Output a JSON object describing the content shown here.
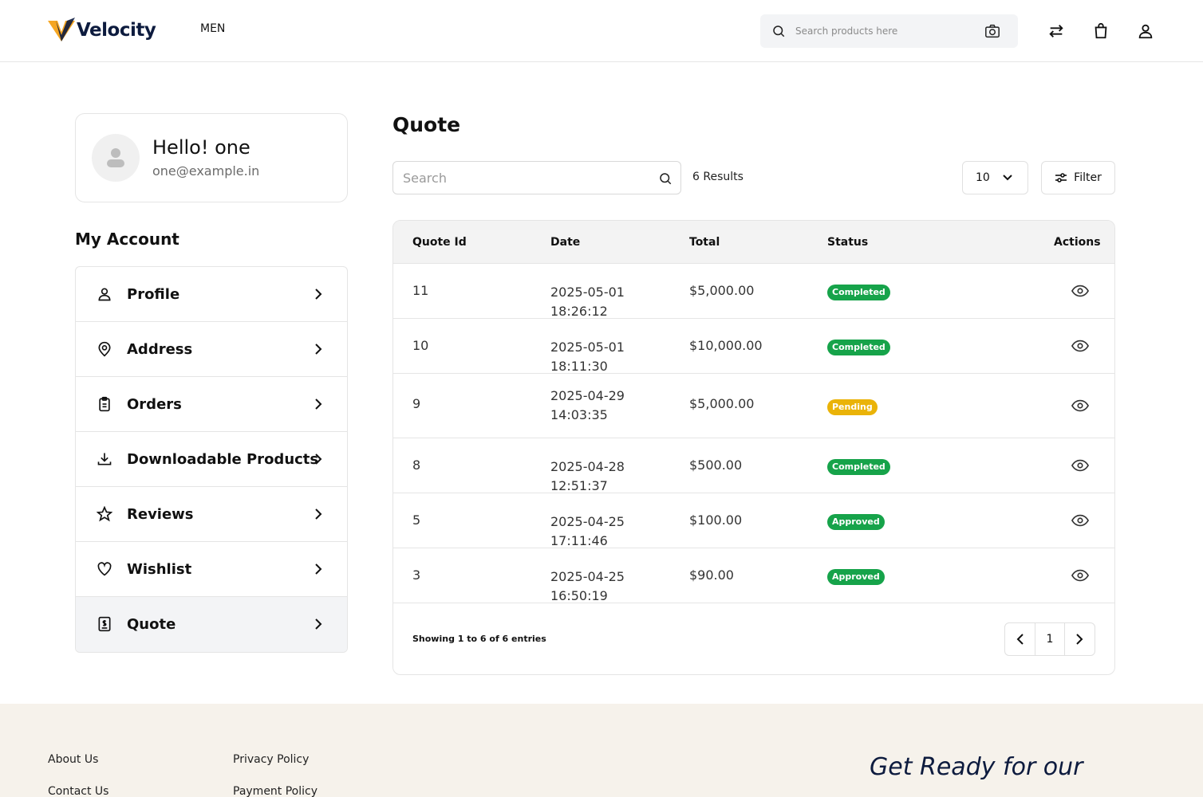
{
  "header": {
    "brand": "Velocity",
    "nav": [
      "MEN"
    ],
    "search_placeholder": "Search products here"
  },
  "profile": {
    "greeting": "Hello! one",
    "email": "one@example.in"
  },
  "sidebar": {
    "title": "My Account",
    "items": [
      {
        "label": "Profile",
        "icon": "user-icon"
      },
      {
        "label": "Address",
        "icon": "location-pin-icon"
      },
      {
        "label": "Orders",
        "icon": "clipboard-icon"
      },
      {
        "label": "Downloadable Products",
        "icon": "download-icon"
      },
      {
        "label": "Reviews",
        "icon": "star-icon"
      },
      {
        "label": "Wishlist",
        "icon": "heart-icon"
      },
      {
        "label": "Quote",
        "icon": "quote-doc-icon",
        "active": true
      }
    ]
  },
  "main": {
    "title": "Quote",
    "search_placeholder": "Search",
    "results": "6 Results",
    "per_page": "10",
    "filter_label": "Filter",
    "columns": [
      "Quote Id",
      "Date",
      "Total",
      "Status",
      "Actions"
    ],
    "rows": [
      {
        "id": "11",
        "date": "2025-05-01 18:26:12",
        "total": "$5,000.00",
        "status": "Completed"
      },
      {
        "id": "10",
        "date": "2025-05-01 18:11:30",
        "total": "$10,000.00",
        "status": "Completed"
      },
      {
        "id": "9",
        "date": "2025-04-29 14:03:35",
        "total": "$5,000.00",
        "status": "Pending"
      },
      {
        "id": "8",
        "date": "2025-04-28 12:51:37",
        "total": "$500.00",
        "status": "Completed"
      },
      {
        "id": "5",
        "date": "2025-04-25 17:11:46",
        "total": "$100.00",
        "status": "Approved"
      },
      {
        "id": "3",
        "date": "2025-04-25 16:50:19",
        "total": "$90.00",
        "status": "Approved"
      }
    ],
    "showing": "Showing 1 to 6 of 6 entries",
    "current_page": "1"
  },
  "status_colors": {
    "Completed": "#16a34a",
    "Approved": "#16a34a",
    "Pending": "#eab308"
  },
  "footer": {
    "col1": [
      "About Us",
      "Contact Us"
    ],
    "col2": [
      "Privacy Policy",
      "Payment Policy"
    ],
    "tagline": "Get Ready for our"
  }
}
